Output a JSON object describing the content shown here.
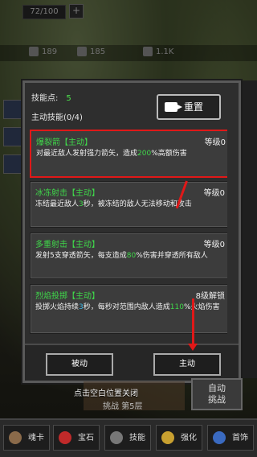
{
  "hud": {
    "hp": "72/100",
    "plus": "+",
    "stat1": "189",
    "stat2": "185",
    "stat3": "1.1K"
  },
  "panel": {
    "skill_points_label": "技能点:",
    "skill_points_value": "5",
    "main_skills_label": "主动技能(0/4)",
    "reset_label": "重置",
    "skills": [
      {
        "name": "爆裂箭【主动】",
        "level": "等级0",
        "desc_pre": "对最近敌人发射强力箭矢，造成",
        "desc_num": "200",
        "desc_post": "%高额伤害"
      },
      {
        "name": "冰冻射击【主动】",
        "level": "等级0",
        "desc_pre": "冻结最近敌人",
        "desc_num": "3",
        "desc_post": "秒，被冻结的敌人无法移动和攻击"
      },
      {
        "name": "多重射击【主动】",
        "level": "等级0",
        "desc_pre": "发射5支穿透箭矢，每支造成",
        "desc_num": "80",
        "desc_post": "%伤害并穿透所有敌人"
      },
      {
        "name": "烈焰投掷【主动】",
        "level": "8级解锁",
        "desc_pre": "投掷火焰持续",
        "desc_num": "3",
        "desc_mid": "秒，每秒对范围内敌人造成",
        "desc_num2": "110",
        "desc_post": "%火焰伤害"
      }
    ],
    "tab_passive": "被动",
    "tab_active": "主动"
  },
  "footer": {
    "close_hint": "点击空白位置关闭",
    "challenge_sub": "挑战 第5层",
    "auto_line1": "自动",
    "auto_line2": "挑战"
  },
  "nav": [
    {
      "label": "魂卡",
      "icon": "soul-card-icon"
    },
    {
      "label": "宝石",
      "icon": "gem-icon"
    },
    {
      "label": "技能",
      "icon": "skill-icon"
    },
    {
      "label": "强化",
      "icon": "enhance-icon"
    },
    {
      "label": "首饰",
      "icon": "jewelry-icon"
    }
  ],
  "colors": {
    "highlight": "#e01818",
    "green": "#3fd84a"
  }
}
